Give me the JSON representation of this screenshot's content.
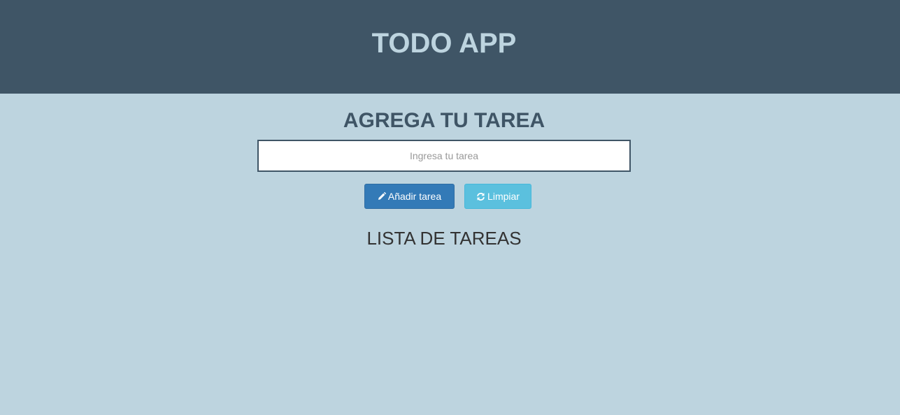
{
  "header": {
    "title": "TODO APP"
  },
  "form": {
    "heading": "AGREGA TU TAREA",
    "input_placeholder": "Ingresa tu tarea",
    "input_value": "",
    "add_button_label": "Añadir tarea",
    "add_button_icon": "pencil-icon",
    "clear_button_label": "Limpiar",
    "clear_button_icon": "refresh-icon"
  },
  "list": {
    "heading": "LISTA DE TAREAS",
    "items": []
  },
  "colors": {
    "header_bg": "#3f5566",
    "page_bg": "#bdd4df",
    "primary_button": "#337ab7",
    "info_button": "#5bc0de"
  }
}
